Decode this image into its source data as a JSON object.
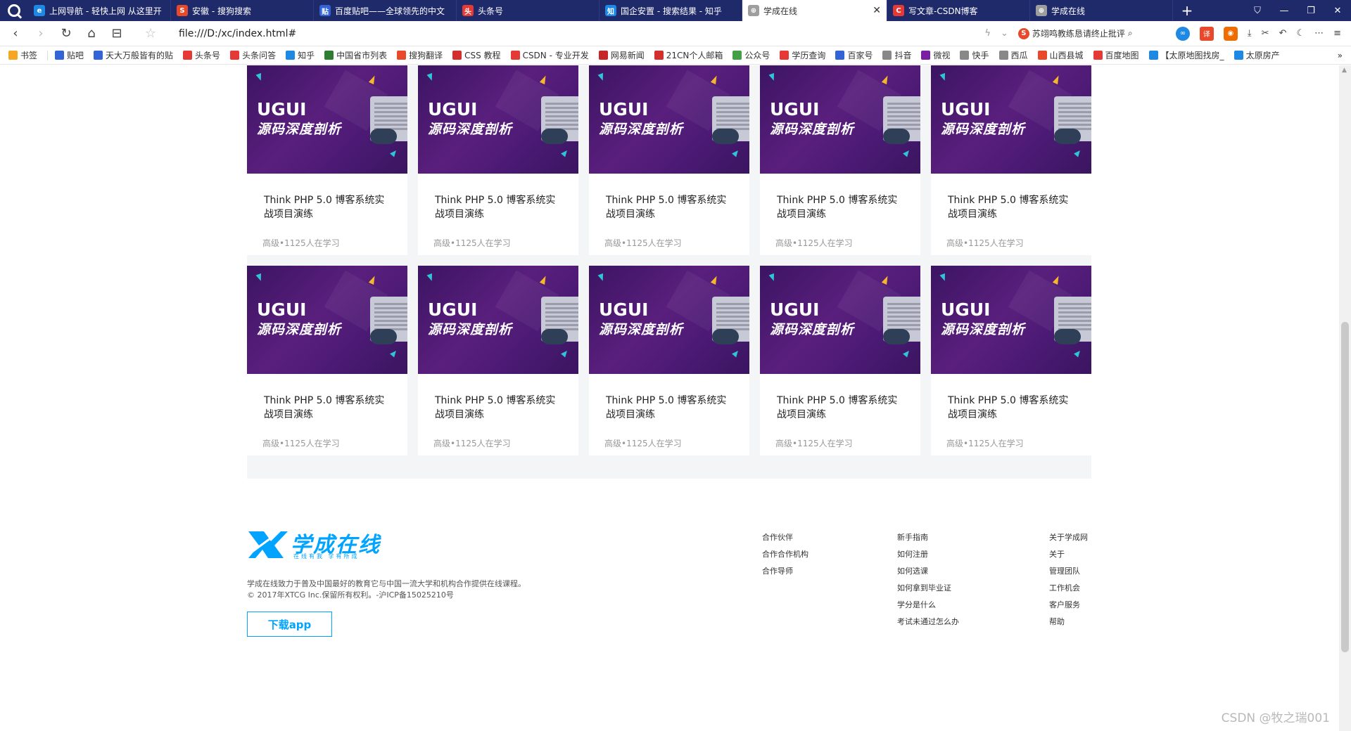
{
  "tabs": [
    {
      "label": "上网导航 - 轻快上网 从这里开",
      "fav_color": "#1e88e5",
      "fav_glyph": "e"
    },
    {
      "label": "安徽 - 搜狗搜索",
      "fav_color": "#e8492b",
      "fav_glyph": "S"
    },
    {
      "label": "百度贴吧——全球领先的中文",
      "fav_color": "#3264d7",
      "fav_glyph": "贴"
    },
    {
      "label": "头条号",
      "fav_color": "#e53935",
      "fav_glyph": "头"
    },
    {
      "label": "国企安置 - 搜索结果 - 知乎",
      "fav_color": "#1e88e5",
      "fav_glyph": "知"
    },
    {
      "label": "学成在线",
      "fav_color": "#9e9e9e",
      "fav_glyph": "⊕",
      "active": true
    },
    {
      "label": "写文章-CSDN博客",
      "fav_color": "#e53935",
      "fav_glyph": "C"
    },
    {
      "label": "学成在线",
      "fav_color": "#9e9e9e",
      "fav_glyph": "⊕"
    }
  ],
  "address": {
    "url": "file:///D:/xc/index.html#",
    "search_hint": "苏翊鸣教练恳请终止批评"
  },
  "bookmarks": [
    {
      "label": "书签",
      "color": "#f5a623"
    },
    {
      "label": "贴吧",
      "color": "#3264d7"
    },
    {
      "label": "天大万般皆有的贴",
      "color": "#3264d7"
    },
    {
      "label": "头条号",
      "color": "#e53935"
    },
    {
      "label": "头条问答",
      "color": "#e53935"
    },
    {
      "label": "知乎",
      "color": "#1e88e5"
    },
    {
      "label": "中国省市列表",
      "color": "#2e7d32"
    },
    {
      "label": "搜狗翻译",
      "color": "#e8492b"
    },
    {
      "label": "CSS 教程",
      "color": "#d32f2f"
    },
    {
      "label": "CSDN - 专业开发",
      "color": "#e53935"
    },
    {
      "label": "网易新闻",
      "color": "#c62828"
    },
    {
      "label": "21CN个人邮箱",
      "color": "#d32f2f"
    },
    {
      "label": "公众号",
      "color": "#43a047"
    },
    {
      "label": "学历查询",
      "color": "#e53935"
    },
    {
      "label": "百家号",
      "color": "#3264d7"
    },
    {
      "label": "抖音",
      "color": "#888888"
    },
    {
      "label": "微视",
      "color": "#7b1fa2"
    },
    {
      "label": "快手",
      "color": "#888888"
    },
    {
      "label": "西瓜",
      "color": "#888888"
    },
    {
      "label": "山西县城",
      "color": "#e8492b"
    },
    {
      "label": "百度地图",
      "color": "#e53935"
    },
    {
      "label": "【太原地图找房_",
      "color": "#1e88e5"
    },
    {
      "label": "太原房产",
      "color": "#1e88e5"
    }
  ],
  "course": {
    "banner_line1": "UGUI",
    "banner_line2": "源码深度剖析",
    "title": "Think PHP 5.0 博客系统实战项目演练",
    "meta": "高级•1125人在学习"
  },
  "footer": {
    "logo_text": "学成在线",
    "logo_slogan": "在线有我 学有所成",
    "desc_line1": "学成在线致力于普及中国最好的教育它与中国一流大学和机构合作提供在线课程。",
    "desc_line2": "© 2017年XTCG Inc.保留所有权利。-沪ICP备15025210号",
    "download_label": "下载app",
    "col1": [
      "合作伙伴",
      "合作合作机构",
      "合作导师"
    ],
    "col2": [
      "新手指南",
      "如何注册",
      "如何选课",
      "如何拿到毕业证",
      "学分是什么",
      "考试未通过怎么办"
    ],
    "col3": [
      "关于学成网",
      "关于",
      "管理团队",
      "工作机会",
      "客户服务",
      "帮助"
    ]
  },
  "watermark": "CSDN @牧之瑞001"
}
